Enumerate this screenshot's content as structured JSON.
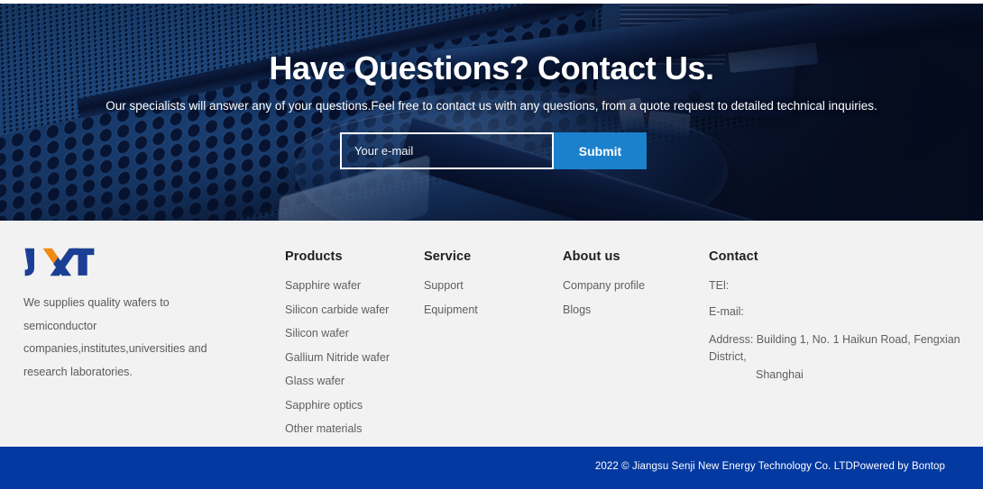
{
  "hero": {
    "title": "Have Questions? Contact Us.",
    "subtitle": "Our specialists will answer any of your questions.Feel free to contact us with any questions, from a quote request to detailed technical inquiries.",
    "email_placeholder": "Your e-mail",
    "email_value": "",
    "submit_label": "Submit",
    "background_image": "industrial-wafer-machine-photo",
    "accent_color": "#1c81cd",
    "overlay_color": "#0d2550"
  },
  "footer": {
    "background_color": "#f2f2f2",
    "brand": {
      "logo_text": "JXT",
      "logo_primary_color": "#1b3f94",
      "logo_accent_color": "#f08a13",
      "description": "We supplies quality wafers to semiconductor companies,institutes,universities and research laboratories."
    },
    "columns": [
      {
        "title": "Products",
        "links": [
          "Sapphire wafer",
          "Silicon carbide wafer",
          "Silicon wafer",
          "Gallium Nitride wafer",
          "Glass wafer",
          "Sapphire optics",
          "Other materials"
        ]
      },
      {
        "title": "Service",
        "links": [
          "Support",
          "Equipment"
        ]
      },
      {
        "title": "About us",
        "links": [
          "Company profile",
          "Blogs"
        ]
      }
    ],
    "contact": {
      "title": "Contact",
      "tel_label": "TEl:",
      "email_label": "E-mail:",
      "address_line1": "Address: Building 1, No. 1 Haikun Road, Fengxian District,",
      "address_line2": "Shanghai"
    }
  },
  "bottom_bar": {
    "background_color": "#0339a0",
    "copyright": "2022 © Jiangsu Senji New Energy Technology Co. LTDPowered by Bontop"
  }
}
